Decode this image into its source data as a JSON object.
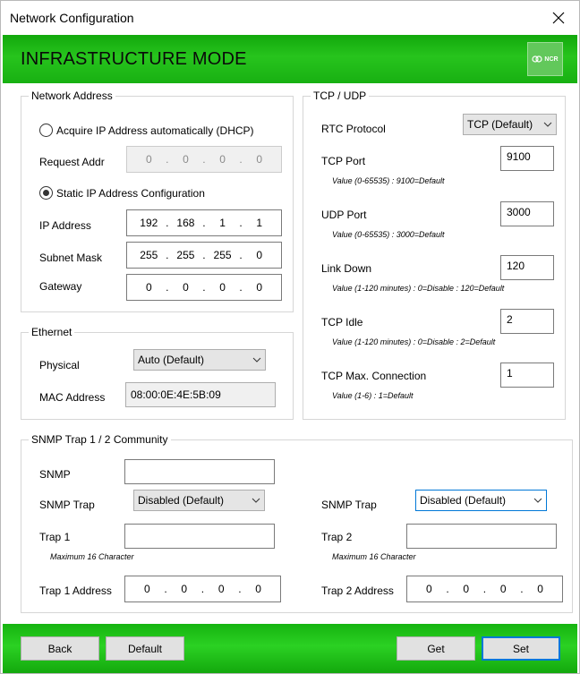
{
  "window": {
    "title": "Network Configuration",
    "close_icon": "close-icon"
  },
  "banner": {
    "mode": "INFRASTRUCTURE MODE",
    "logo_text": "NCR"
  },
  "network_address": {
    "legend": "Network Address",
    "dhcp_label": "Acquire IP Address automatically (DHCP)",
    "dhcp_checked": false,
    "request_addr_label": "Request Addr",
    "request_addr": [
      "0",
      "0",
      "0",
      "0"
    ],
    "static_label": "Static IP Address Configuration",
    "static_checked": true,
    "ip_label": "IP Address",
    "ip": [
      "192",
      "168",
      "1",
      "1"
    ],
    "subnet_label": "Subnet Mask",
    "subnet": [
      "255",
      "255",
      "255",
      "0"
    ],
    "gateway_label": "Gateway",
    "gateway": [
      "0",
      "0",
      "0",
      "0"
    ]
  },
  "ethernet": {
    "legend": "Ethernet",
    "physical_label": "Physical",
    "physical_value": "Auto (Default)",
    "mac_label": "MAC Address",
    "mac_value": "08:00:0E:4E:5B:09"
  },
  "tcp_udp": {
    "legend": "TCP / UDP",
    "rtc_label": "RTC Protocol",
    "rtc_value": "TCP (Default)",
    "tcp_port_label": "TCP Port",
    "tcp_port_value": "9100",
    "tcp_port_hint": "Value (0-65535) : 9100=Default",
    "udp_port_label": "UDP Port",
    "udp_port_value": "3000",
    "udp_port_hint": "Value (0-65535) : 3000=Default",
    "link_down_label": "Link Down",
    "link_down_value": "120",
    "link_down_hint": "Value (1-120 minutes) : 0=Disable : 120=Default",
    "tcp_idle_label": "TCP Idle",
    "tcp_idle_value": "2",
    "tcp_idle_hint": "Value (1-120 minutes) : 0=Disable : 2=Default",
    "tcp_max_label": "TCP Max. Connection",
    "tcp_max_value": "1",
    "tcp_max_hint": "Value (1-6) : 1=Default"
  },
  "snmp": {
    "legend": "SNMP Trap 1 / 2 Community",
    "snmp_label": "SNMP",
    "snmp_value": "",
    "trap_left_label": "SNMP Trap",
    "trap_left_value": "Disabled (Default)",
    "trap_right_label": "SNMP Trap",
    "trap_right_value": "Disabled (Default)",
    "trap1_label": "Trap 1",
    "trap1_value": "",
    "trap1_hint": "Maximum 16 Character",
    "trap2_label": "Trap 2",
    "trap2_value": "",
    "trap2_hint": "Maximum 16 Character",
    "trap1_addr_label": "Trap 1 Address",
    "trap1_addr": [
      "0",
      "0",
      "0",
      "0"
    ],
    "trap2_addr_label": "Trap 2 Address",
    "trap2_addr": [
      "0",
      "0",
      "0",
      "0"
    ]
  },
  "footer": {
    "back": "Back",
    "default": "Default",
    "get": "Get",
    "set": "Set"
  },
  "colors": {
    "accent_green": "#27c41d",
    "focus_blue": "#0078d7"
  }
}
